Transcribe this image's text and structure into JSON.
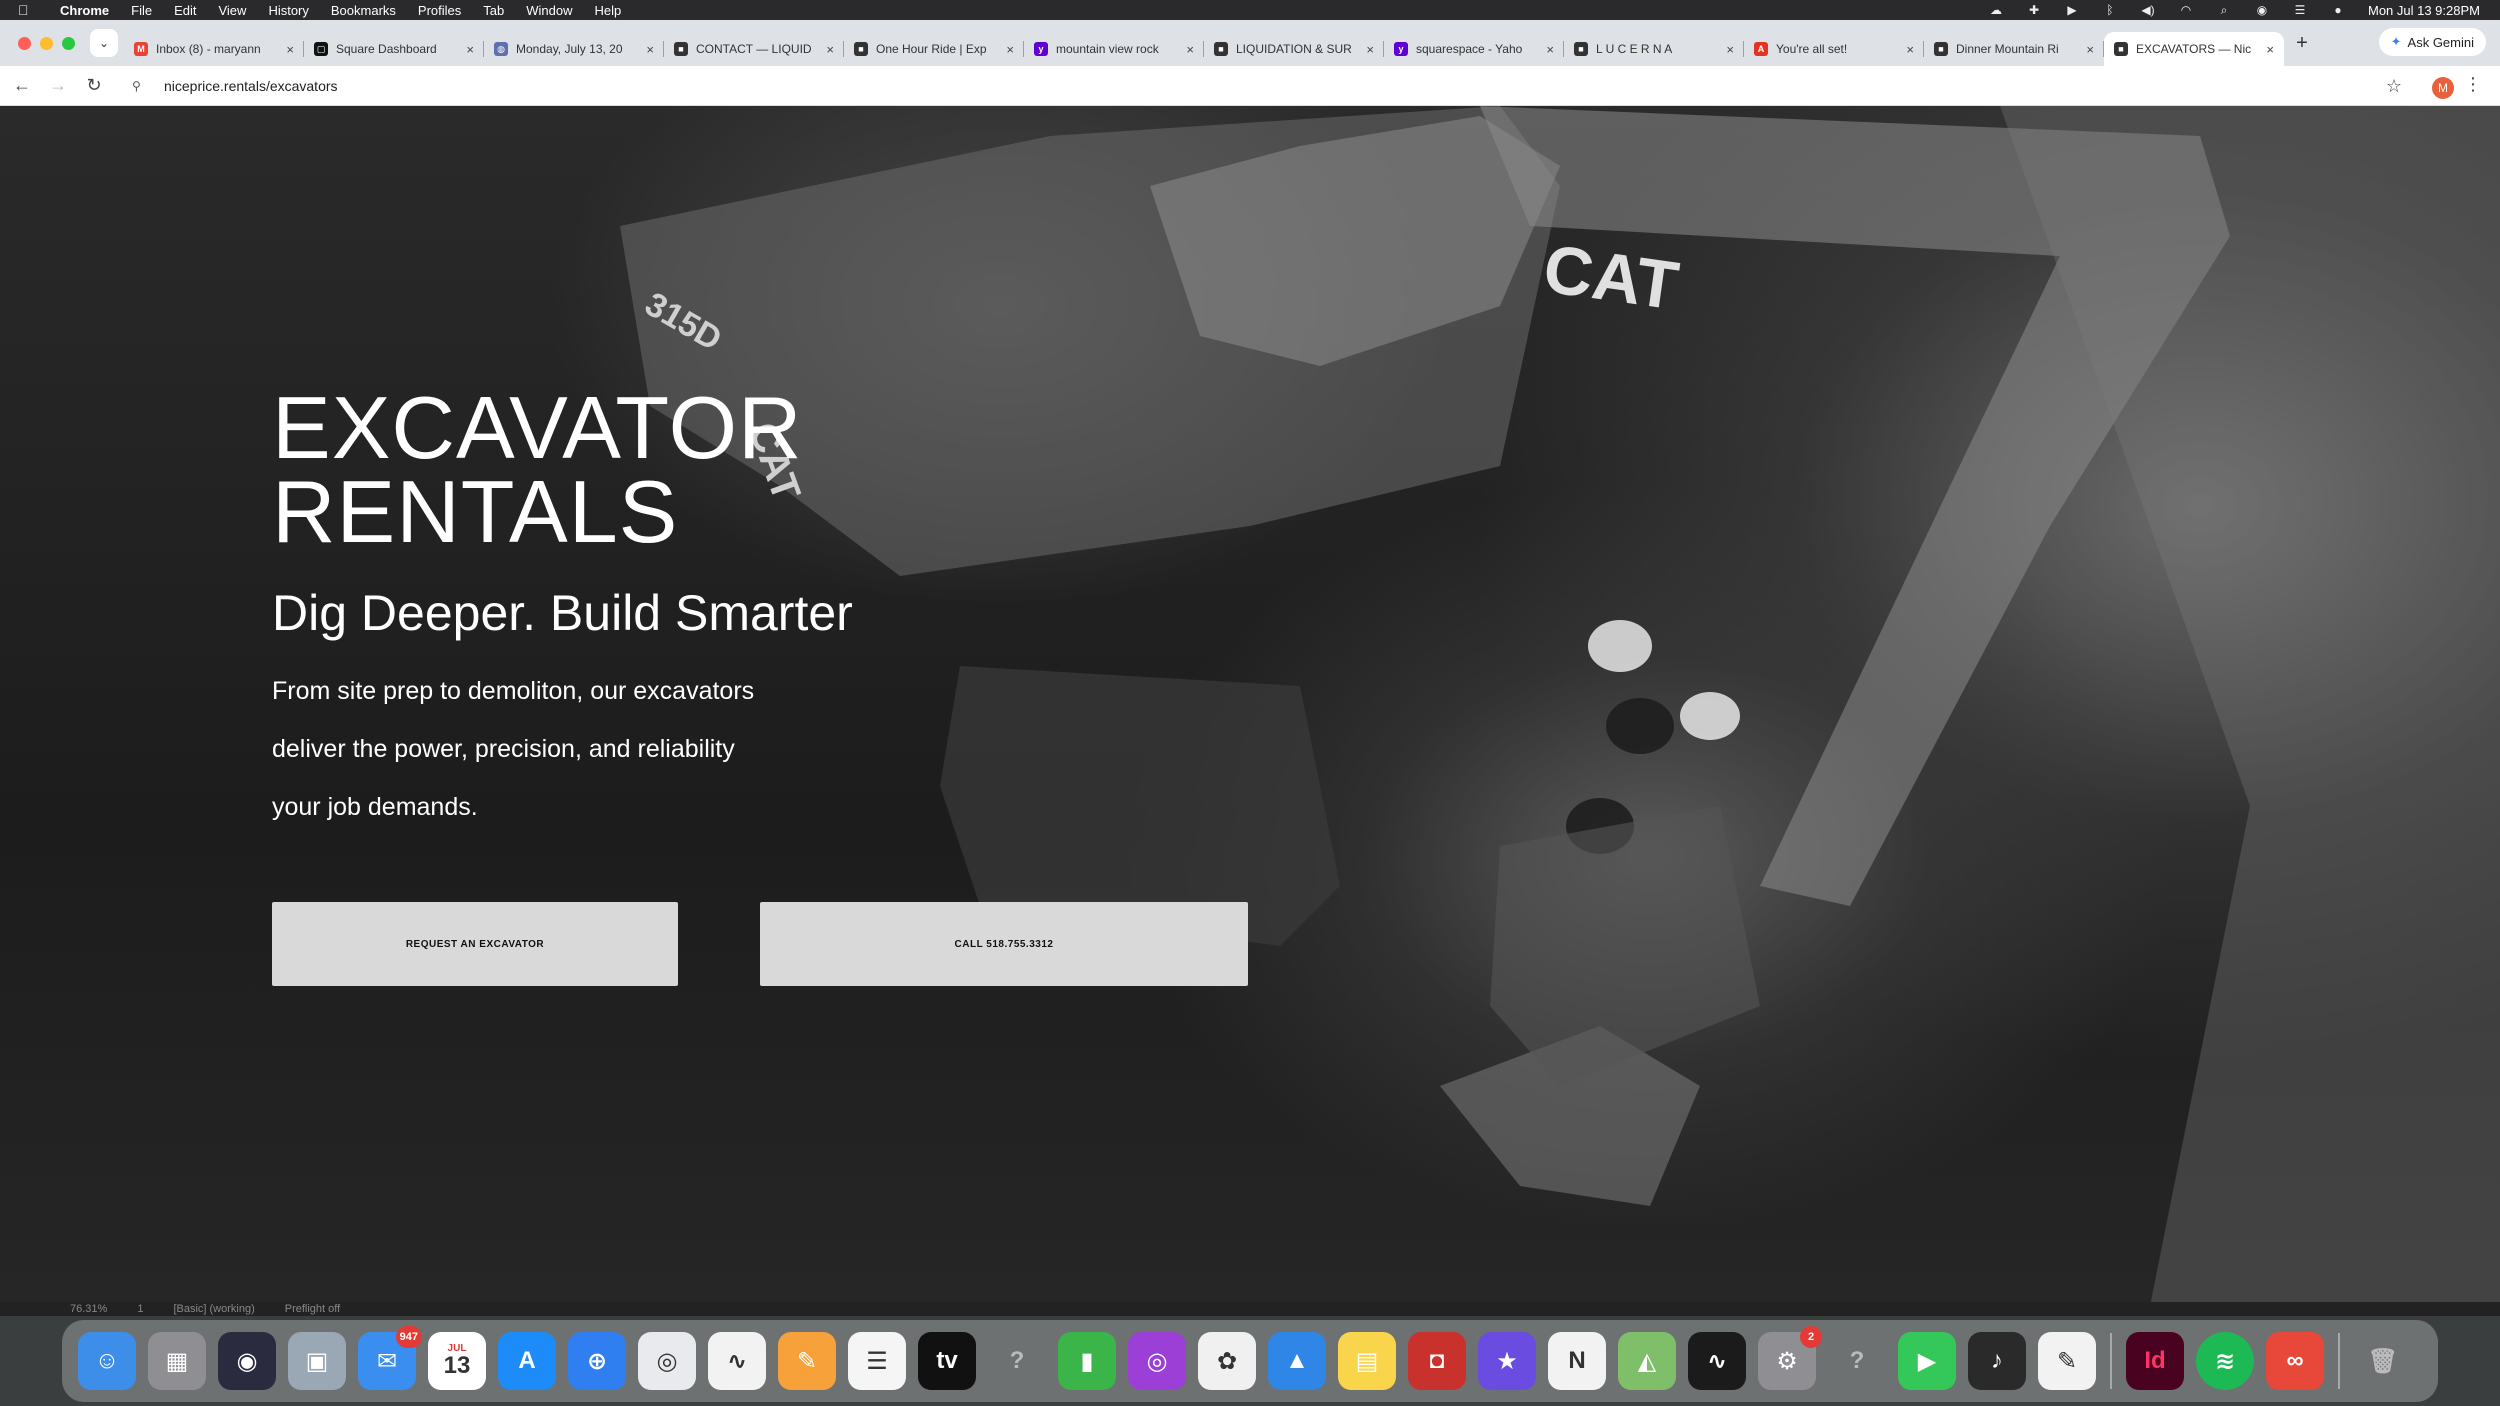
{
  "menubar": {
    "app": "Chrome",
    "items": [
      "File",
      "Edit",
      "View",
      "History",
      "Bookmarks",
      "Profiles",
      "Tab",
      "Window",
      "Help"
    ],
    "clock": "Mon Jul 13  9:28PM"
  },
  "tabs": [
    {
      "title": "Inbox (8) - maryann",
      "favicon": "gmail-icon",
      "color": "#ea4335",
      "glyph": "M"
    },
    {
      "title": "Square Dashboard",
      "favicon": "square-icon",
      "color": "#111111",
      "glyph": "▢"
    },
    {
      "title": "Monday, July 13, 20",
      "favicon": "globe-icon",
      "color": "#5f6fb0",
      "glyph": "◍"
    },
    {
      "title": "CONTACT — LIQUID",
      "favicon": "squarespace-icon",
      "color": "#333333",
      "glyph": "■"
    },
    {
      "title": "One Hour Ride | Exp",
      "favicon": "squarespace-icon",
      "color": "#333333",
      "glyph": "■"
    },
    {
      "title": "mountain view rock",
      "favicon": "yahoo-icon",
      "color": "#6001d2",
      "glyph": "y"
    },
    {
      "title": "LIQUIDATION & SUR",
      "favicon": "squarespace-icon",
      "color": "#333333",
      "glyph": "■"
    },
    {
      "title": "squarespace - Yaho",
      "favicon": "yahoo-icon",
      "color": "#6001d2",
      "glyph": "y"
    },
    {
      "title": "L U C E R N A",
      "favicon": "squarespace-icon",
      "color": "#333333",
      "glyph": "■"
    },
    {
      "title": "You're all set!",
      "favicon": "adobe-icon",
      "color": "#e4331f",
      "glyph": "A"
    },
    {
      "title": "Dinner Mountain Ri",
      "favicon": "squarespace-icon",
      "color": "#333333",
      "glyph": "■"
    },
    {
      "title": "EXCAVATORS — Nic",
      "favicon": "squarespace-icon",
      "color": "#333333",
      "glyph": "■",
      "active": true
    }
  ],
  "gemini_label": "Ask Gemini",
  "address": {
    "url": "niceprice.rentals/excavators",
    "profile_initial": "M"
  },
  "hero": {
    "title_line1": "EXCAVATOR",
    "title_line2": "RENTALS",
    "subtitle": "Dig Deeper.  Build Smarter",
    "body_line1": "From site prep to demoliton, our excavators",
    "body_line2": "deliver the power, precision, and reliability",
    "body_line3": "your job demands.",
    "btn_request": "REQUEST AN EXCAVATOR",
    "btn_call": "CALL 518.755.3312"
  },
  "status": {
    "zoom": "76.31%",
    "page": "1",
    "mode": "[Basic] (working)",
    "preflight": "Preflight off"
  },
  "dock": [
    {
      "name": "finder-icon",
      "color": "#3d8ee8",
      "glyph": "☺"
    },
    {
      "name": "launchpad-icon",
      "color": "#8e8e93",
      "glyph": "▦"
    },
    {
      "name": "siri-icon",
      "color": "#2b2b40",
      "glyph": "◉"
    },
    {
      "name": "preview-icon",
      "color": "#9aa7b5",
      "glyph": "▣"
    },
    {
      "name": "mail-icon",
      "color": "#3a8ef0",
      "glyph": "✉",
      "badge": "947"
    },
    {
      "name": "calendar-icon",
      "color": "#ffffff",
      "glyph": "13",
      "dark": true,
      "label": "JUL"
    },
    {
      "name": "app-store-icon",
      "color": "#1d8cf8",
      "glyph": "A"
    },
    {
      "name": "safari-icon",
      "color": "#2f7ff0",
      "glyph": "⊕"
    },
    {
      "name": "chrome-icon",
      "color": "#e8eaed",
      "glyph": "◎",
      "dark": true
    },
    {
      "name": "freeform-icon",
      "color": "#f2f2f2",
      "glyph": "∿",
      "dark": true
    },
    {
      "name": "pages-icon",
      "color": "#f7a13a",
      "glyph": "✎"
    },
    {
      "name": "reminders-icon",
      "color": "#f5f5f5",
      "glyph": "☰",
      "dark": true
    },
    {
      "name": "apple-tv-icon",
      "color": "#111111",
      "glyph": "tv"
    },
    {
      "name": "unknown-app-icon",
      "color": "transparent",
      "glyph": "?"
    },
    {
      "name": "numbers-icon",
      "color": "#3bb54a",
      "glyph": "▮"
    },
    {
      "name": "podcasts-icon",
      "color": "#9b3fd6",
      "glyph": "◎"
    },
    {
      "name": "photos-icon",
      "color": "#f0f0f0",
      "glyph": "✿",
      "dark": true
    },
    {
      "name": "keynote-icon",
      "color": "#2f86e6",
      "glyph": "▲"
    },
    {
      "name": "notes-icon",
      "color": "#f8d54a",
      "glyph": "▤"
    },
    {
      "name": "photo-booth-icon",
      "color": "#c9312c",
      "glyph": "◘"
    },
    {
      "name": "imovie-icon",
      "color": "#6a4ce0",
      "glyph": "★"
    },
    {
      "name": "news-icon",
      "color": "#f2f2f2",
      "glyph": "N",
      "dark": true
    },
    {
      "name": "maps-icon",
      "color": "#7fbf6a",
      "glyph": "◭"
    },
    {
      "name": "activity-monitor-icon",
      "color": "#1b1b1b",
      "glyph": "∿"
    },
    {
      "name": "system-settings-icon",
      "color": "#8e8e93",
      "glyph": "⚙",
      "badge": "2"
    },
    {
      "name": "unknown-app-icon-2",
      "color": "transparent",
      "glyph": "?"
    },
    {
      "name": "facetime-icon",
      "color": "#34c759",
      "glyph": "▶"
    },
    {
      "name": "garageband-icon",
      "color": "#2a2a2a",
      "glyph": "♪"
    },
    {
      "name": "textedit-icon",
      "color": "#f2f2f2",
      "glyph": "✎",
      "dark": true
    },
    {
      "sep": true
    },
    {
      "name": "indesign-icon",
      "color": "#49021f",
      "glyph": "Id",
      "fg": "#ff3366"
    },
    {
      "name": "spotify-icon",
      "color": "#1db954",
      "glyph": "≋",
      "round": true,
      "bg2": "#000"
    },
    {
      "name": "creative-cloud-icon",
      "color": "#e8483a",
      "glyph": "∞"
    },
    {
      "sep": true
    },
    {
      "name": "trash-icon",
      "color": "transparent",
      "glyph": "🗑"
    }
  ],
  "colors": {
    "button_bg": "#d9d9d9",
    "hero_text": "#ffffff"
  }
}
